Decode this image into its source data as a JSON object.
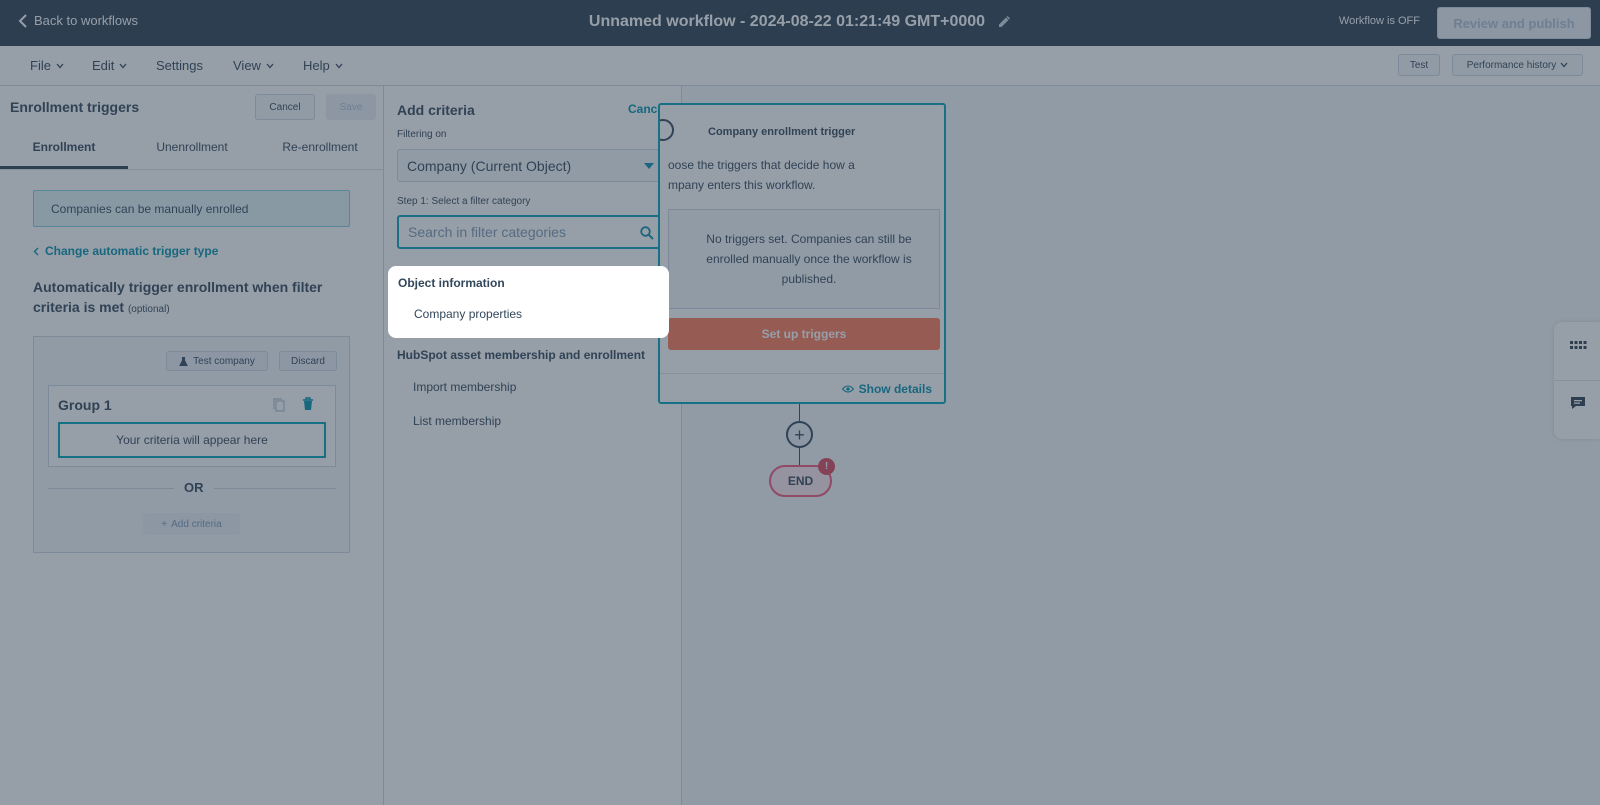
{
  "header": {
    "back_label": "Back to workflows",
    "workflow_title": "Unnamed workflow - 2024-08-22 01:21:49 GMT+0000",
    "status": "Workflow is OFF",
    "publish_label": "Review and publish"
  },
  "menubar": {
    "items": [
      "File",
      "Edit",
      "Settings",
      "View",
      "Help"
    ],
    "test_label": "Test",
    "performance_label": "Performance history"
  },
  "left_panel": {
    "title": "Enrollment triggers",
    "cancel_label": "Cancel",
    "save_label": "Save",
    "tabs": [
      "Enrollment",
      "Unenrollment",
      "Re-enrollment"
    ],
    "active_tab": "Enrollment",
    "manual_notice": "Companies can be manually enrolled",
    "change_link": "Change automatic trigger type",
    "auto_title": "Automatically trigger enrollment when filter criteria is met",
    "auto_optional": "(optional)",
    "test_company_label": "Test company",
    "discard_label": "Discard",
    "group_title": "Group 1",
    "criteria_placeholder": "Your criteria will appear here",
    "or_label": "OR",
    "add_criteria_label": "Add criteria"
  },
  "add_criteria": {
    "title": "Add criteria",
    "cancel_label": "Cancel",
    "filtering_label": "Filtering on",
    "filtering_value": "Company (Current Object)",
    "step_label": "Step 1: Select a filter category",
    "search_placeholder": "Search in filter categories",
    "categories": [
      {
        "title": "Object information",
        "items": [
          "Company properties"
        ]
      },
      {
        "title": "HubSpot asset membership and enrollment",
        "items": [
          "Import membership",
          "List membership"
        ]
      }
    ]
  },
  "canvas": {
    "trigger_title": "Company enrollment trigger",
    "trigger_desc": "oose the triggers that decide how a mpany enters this workflow.",
    "trigger_desc_line1": "oose the triggers that decide how a",
    "trigger_desc_line2": "mpany enters this workflow.",
    "notice": "No triggers set. Companies can still be enrolled manually once the workflow is published.",
    "setup_label": "Set up triggers",
    "show_details_label": "Show details",
    "end_label": "END",
    "end_badge": "!"
  },
  "colors": {
    "header_bg": "#2d3e50",
    "accent": "#00a4bd",
    "link": "#0091ae",
    "setup_button": "#ff7a59",
    "end_border": "#f2547d"
  }
}
